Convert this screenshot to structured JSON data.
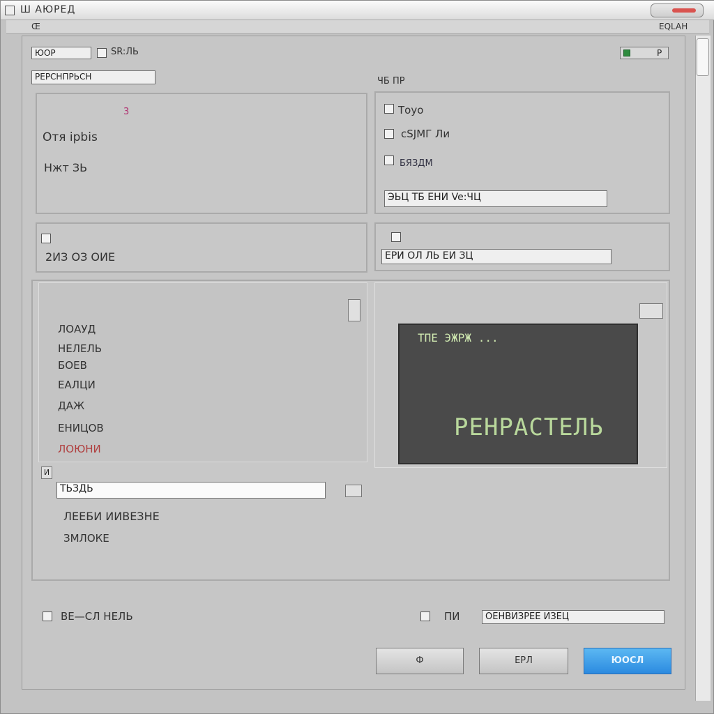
{
  "window": {
    "title": "Ш  AЮРЕД",
    "menu_left": "Œ",
    "menu_right": "EQLAH"
  },
  "top": {
    "field_label": "ЮОР",
    "combo_label": "SR:ЛЬ",
    "corner_label": "P"
  },
  "group1": {
    "header": "PEPCHПРЬСН",
    "mark": "3",
    "line1": "Отя ipbis",
    "line2": "Нжт ЗЬ"
  },
  "group2": {
    "header": "ЧБ ПР",
    "item1": "Тоуо",
    "item2": "сSJМГ Ли",
    "item3": "БЯЗДМ",
    "field": "ЭЬЦ ТБ ЕНИ Ve:ЧЦ"
  },
  "group3": {
    "line": "2ИЗ ОЗ ОИЕ"
  },
  "group4": {
    "field": "ЕРИ ОЛ ЛЬ ЕИ ЗЦ"
  },
  "list": {
    "items": [
      "ЛОАУД",
      "НЕЛЕЛЬ",
      "БОЕВ",
      "ЕАЛЦИ",
      "ДАЖ",
      "ЕНИЦОВ",
      "ЛОЮНИ"
    ]
  },
  "bottom_left": {
    "tag": "И",
    "input_value": "ТЬЗДЬ",
    "line1": "ЛЕЕБИ ИИВЕЗНЕ",
    "line2": "ЗМЛОКЕ"
  },
  "preview": {
    "top_text": "ТПЕ ЭЖРЖ ...",
    "big_text": "РЕНРАСТЕЛЬ"
  },
  "options": {
    "left_label": "ВЕ—СЛ НЕЛЬ",
    "right_label_1": "ПИ",
    "right_label_2": "ОЕНВИЗРЕЕ ИЗЕЦ"
  },
  "buttons": {
    "ok": "Ф",
    "cancel": "ЕРЛ",
    "primary": "ЮОСЛ"
  },
  "colors": {
    "primary_button": "#2b8ae0",
    "close_accent": "#d9534f",
    "preview_bg": "#4a4a4a"
  }
}
